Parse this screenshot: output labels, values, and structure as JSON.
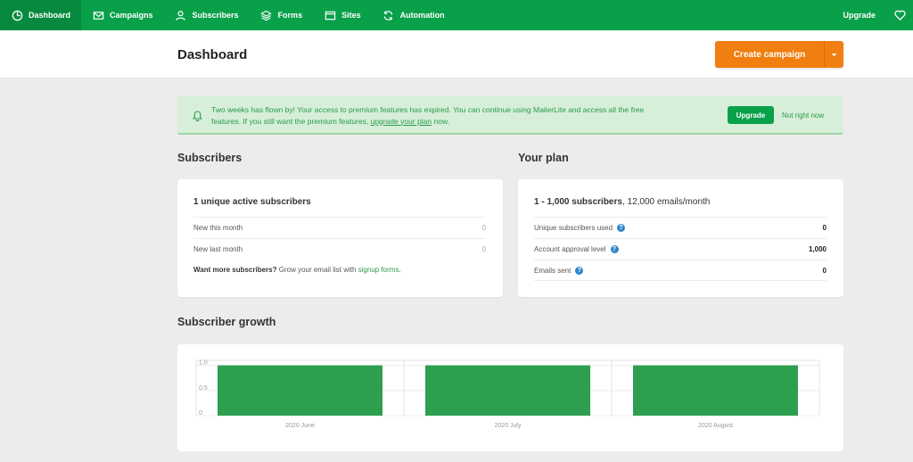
{
  "nav": {
    "items": [
      {
        "label": "Dashboard",
        "icon": "dashboard-icon",
        "active": true
      },
      {
        "label": "Campaigns",
        "icon": "envelope-icon",
        "active": false
      },
      {
        "label": "Subscribers",
        "icon": "user-icon",
        "active": false
      },
      {
        "label": "Forms",
        "icon": "layers-icon",
        "active": false
      },
      {
        "label": "Sites",
        "icon": "browser-icon",
        "active": false
      },
      {
        "label": "Automation",
        "icon": "refresh-icon",
        "active": false
      }
    ],
    "upgrade": "Upgrade",
    "heart_icon": "heart-icon"
  },
  "header": {
    "title": "Dashboard",
    "create_campaign": "Create campaign"
  },
  "alert": {
    "text_part1": "Two weeks has flown by! Your access to premium features has expired. You can continue using MailerLite and access all the free features. If you still want the premium features, ",
    "link": "upgrade your plan",
    "text_part2": " now.",
    "button": "Upgrade",
    "dismiss": "Not right now"
  },
  "subscribers": {
    "title": "Subscribers",
    "headline": "1 unique active subscribers",
    "rows": [
      {
        "label": "New this month",
        "value": "0"
      },
      {
        "label": "New last month",
        "value": "0"
      }
    ],
    "footnote_bold": "Want more subscribers?",
    "footnote_text": " Grow your email list with ",
    "footnote_link": "signup forms",
    "footnote_end": "."
  },
  "plan": {
    "title": "Your plan",
    "headline_bold": "1 - 1,000 subscribers",
    "headline_rest": ", 12,000 emails/month",
    "rows": [
      {
        "label": "Unique subscribers used",
        "value": "0"
      },
      {
        "label": "Account approval level",
        "value": "1,000"
      },
      {
        "label": "Emails sent",
        "value": "0"
      }
    ]
  },
  "growth": {
    "title": "Subscriber growth"
  },
  "colors": {
    "brand_green": "#09a04a",
    "bar_green": "#2e9e4f",
    "cta_orange": "#f07e10"
  },
  "chart_data": {
    "type": "bar",
    "categories": [
      "2020 June",
      "2020 July",
      "2020 August"
    ],
    "values": [
      1,
      1,
      1
    ],
    "yticks": [
      "1.0",
      "0.5",
      "0"
    ],
    "ylim": [
      0,
      1.1
    ],
    "title": "Subscriber growth",
    "grid": true
  }
}
